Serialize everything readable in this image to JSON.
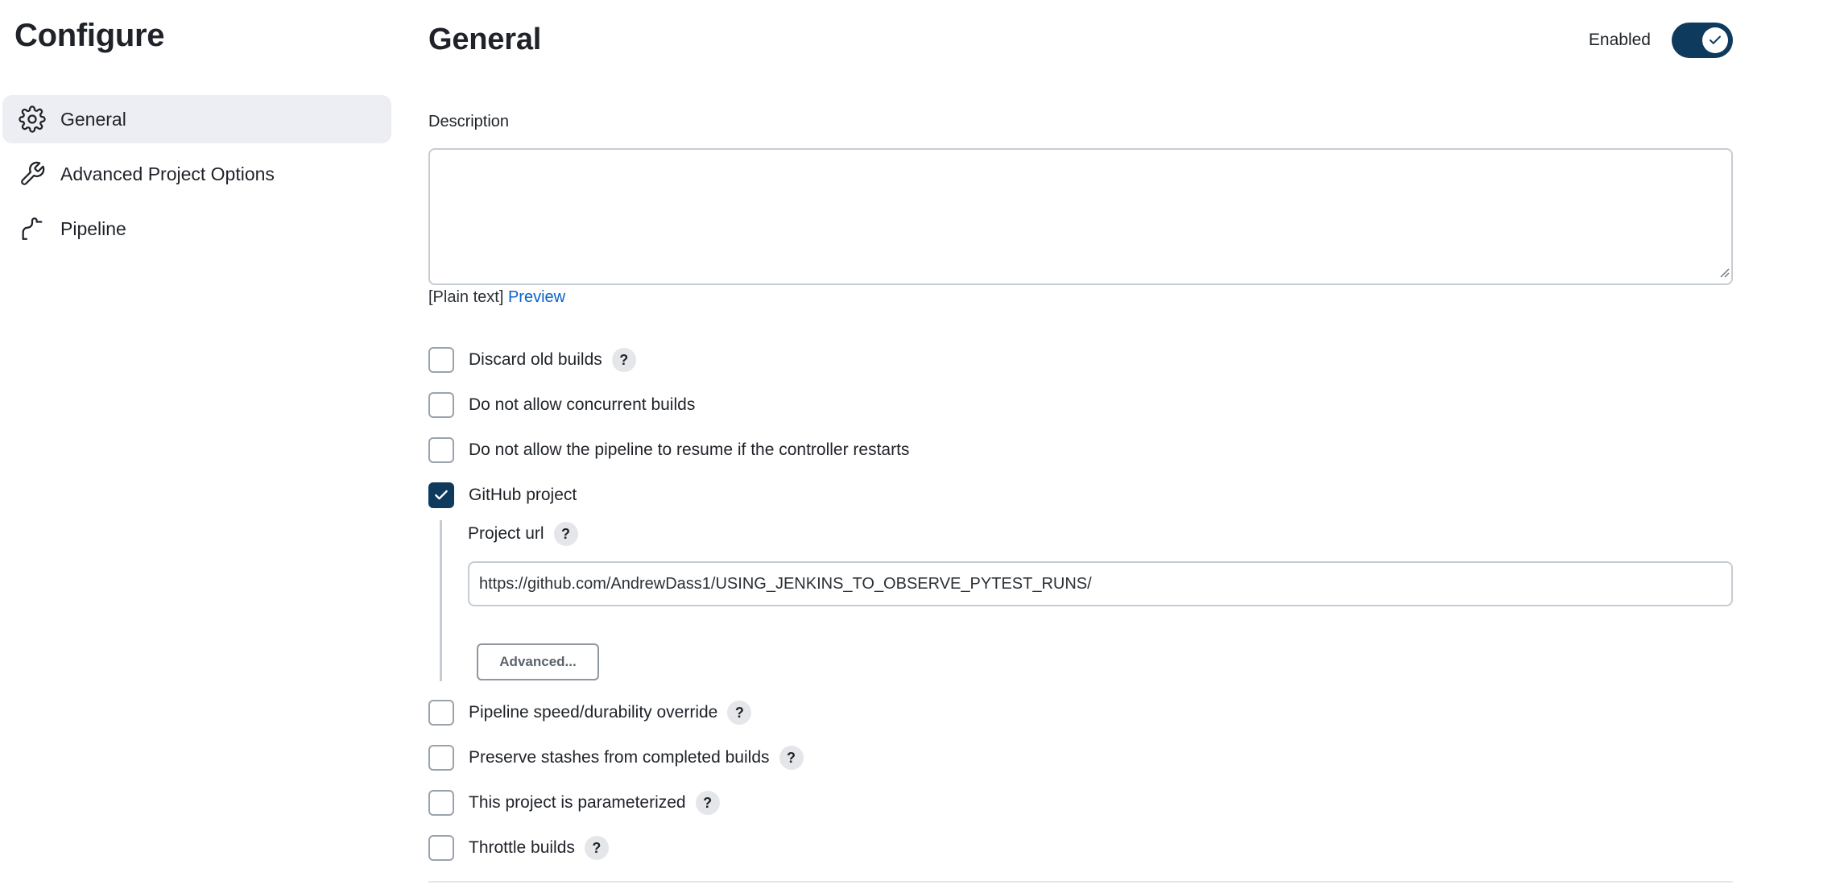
{
  "sidebar": {
    "title": "Configure",
    "items": [
      {
        "label": "General",
        "icon": "gear-icon",
        "active": true
      },
      {
        "label": "Advanced Project Options",
        "icon": "wrench-icon",
        "active": false
      },
      {
        "label": "Pipeline",
        "icon": "pipeline-icon",
        "active": false
      }
    ]
  },
  "main": {
    "title": "General",
    "enabled_label": "Enabled",
    "enabled": true,
    "description": {
      "label": "Description",
      "value": "",
      "format_text": "[Plain text]",
      "preview_link": "Preview"
    },
    "options": [
      {
        "label": "Discard old builds",
        "checked": false,
        "help": "?"
      },
      {
        "label": "Do not allow concurrent builds",
        "checked": false
      },
      {
        "label": "Do not allow the pipeline to resume if the controller restarts",
        "checked": false
      },
      {
        "label": "GitHub project",
        "checked": true
      }
    ],
    "github": {
      "project_url_label": "Project url",
      "help": "?",
      "project_url_value": "https://github.com/AndrewDass1/USING_JENKINS_TO_OBSERVE_PYTEST_RUNS/",
      "advanced_button": "Advanced..."
    },
    "options_after": [
      {
        "label": "Pipeline speed/durability override",
        "checked": false,
        "help": "?"
      },
      {
        "label": "Preserve stashes from completed builds",
        "checked": false,
        "help": "?"
      },
      {
        "label": "This project is parameterized",
        "checked": false,
        "help": "?"
      },
      {
        "label": "Throttle builds",
        "checked": false,
        "help": "?"
      }
    ]
  },
  "colors": {
    "accent": "#0e3a5e",
    "link": "#0a62c9",
    "active_nav_bg": "#eceef3"
  }
}
